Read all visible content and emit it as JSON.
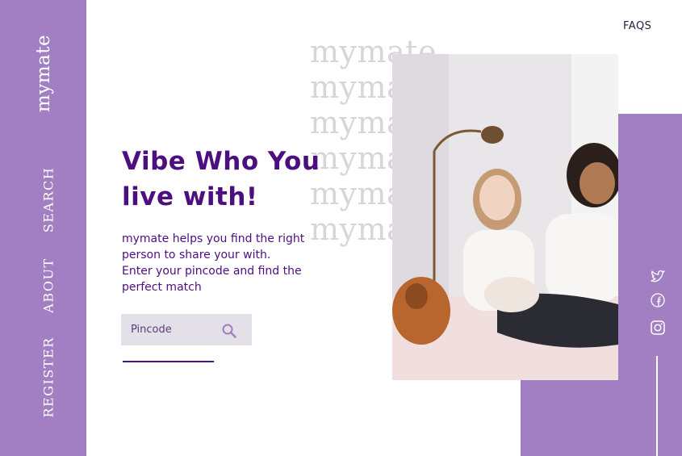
{
  "sidebar": {
    "brand": "mymate",
    "nav": [
      "SEARCH",
      "ABOUT",
      "REGISTER"
    ]
  },
  "header": {
    "faqs": "FAQS"
  },
  "watermark": [
    "mymate",
    "mymate",
    "mymate",
    "mymate",
    "mymate",
    "mymate"
  ],
  "hero": {
    "title_line1": "Vibe Who You",
    "title_line2": "live with!",
    "subtitle_line1": "mymate helps you find the right person to share your with.",
    "subtitle_line2": "Enter your pincode and find the perfect match"
  },
  "search": {
    "placeholder": "Pincode",
    "value": ""
  },
  "social": [
    "twitter-icon",
    "facebook-icon",
    "instagram-icon"
  ],
  "colors": {
    "accent": "#a27fc2",
    "primary_text": "#4d0e7f",
    "watermark": "#d6d6d6"
  }
}
